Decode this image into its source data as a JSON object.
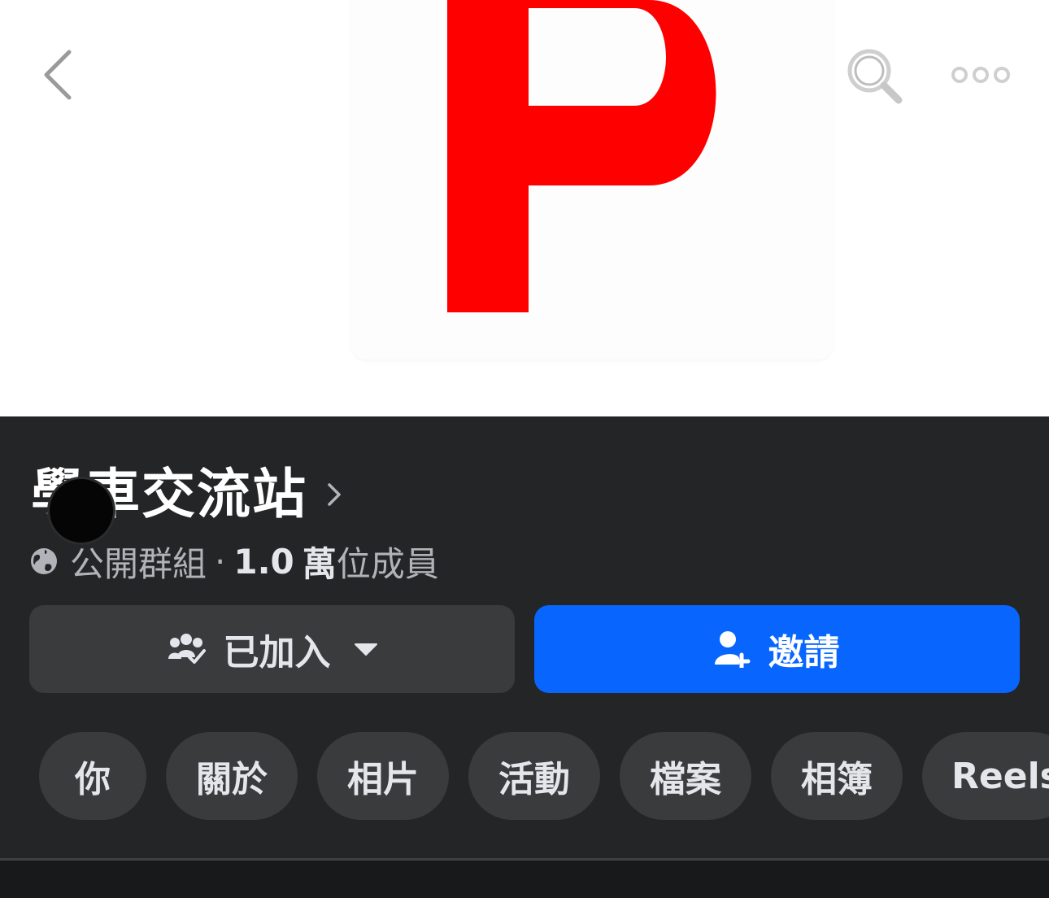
{
  "header": {
    "back_icon": "chevron-left-icon",
    "search_icon": "search-icon",
    "more_icon": "more-horizontal-icon",
    "cover_letter": "P",
    "cover_color": "#ff0000"
  },
  "group": {
    "title": "學車交流站",
    "privacy_icon": "globe-icon",
    "privacy": "公開群組",
    "separator": "·",
    "members_count": "1.0",
    "members_unit": "萬",
    "members_suffix": "位成員"
  },
  "actions": {
    "joined_label": "已加入",
    "joined_icon": "group-check-icon",
    "invite_label": "邀請",
    "invite_icon": "add-person-icon"
  },
  "tabs": [
    {
      "label": "你"
    },
    {
      "label": "關於"
    },
    {
      "label": "相片"
    },
    {
      "label": "活動"
    },
    {
      "label": "檔案"
    },
    {
      "label": "相簿"
    },
    {
      "label": "Reels"
    }
  ],
  "colors": {
    "background": "#242526",
    "chip": "#3a3b3c",
    "primary": "#0866ff",
    "text": "#e4e6eb",
    "secondary_text": "#b0b3b8"
  }
}
